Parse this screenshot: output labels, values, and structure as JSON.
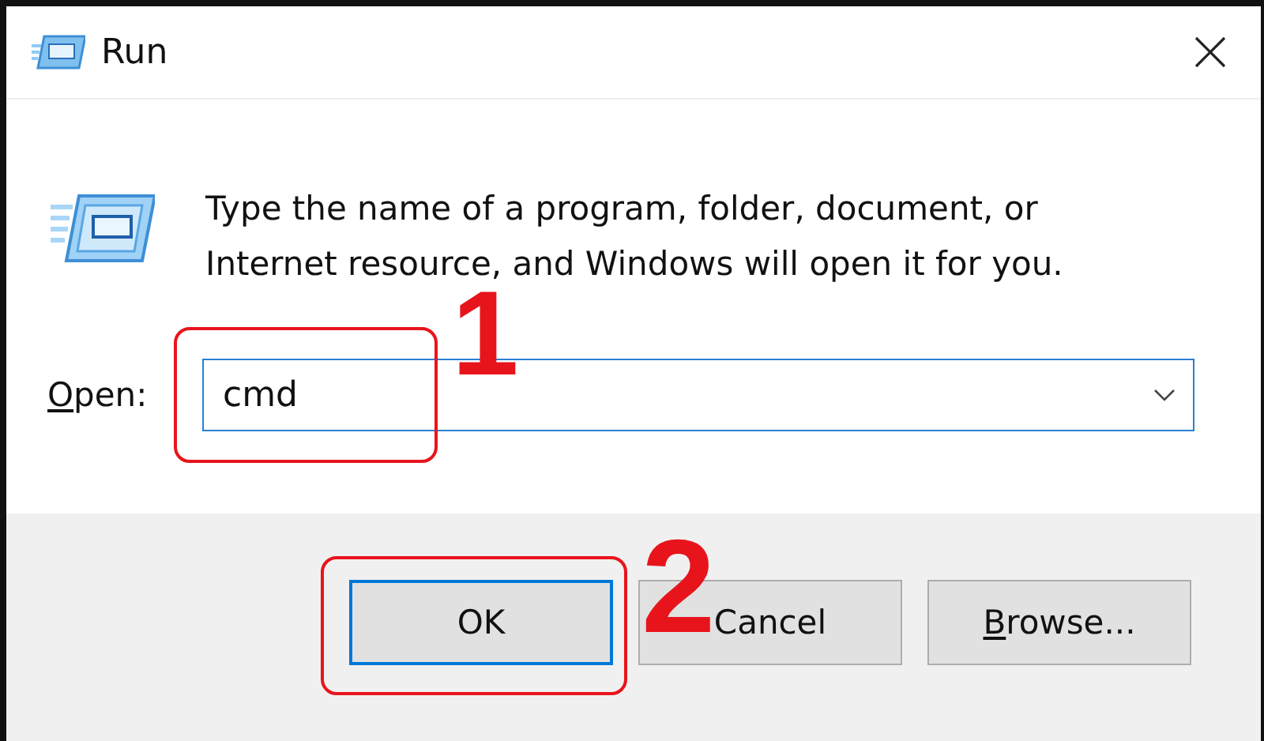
{
  "window": {
    "title": "Run"
  },
  "description": "Type the name of a program, folder, document, or Internet resource, and Windows will open it for you.",
  "open_field": {
    "label": "Open:",
    "label_underline_first": true,
    "value": "cmd"
  },
  "buttons": [
    {
      "label": "OK",
      "default": true,
      "underline_first": false
    },
    {
      "label": "Cancel",
      "default": false,
      "underline_first": false
    },
    {
      "label": "Browse...",
      "default": false,
      "underline_first": true
    }
  ],
  "annotations": [
    {
      "label": "1",
      "kind": "field"
    },
    {
      "label": "2",
      "kind": "ok"
    }
  ]
}
